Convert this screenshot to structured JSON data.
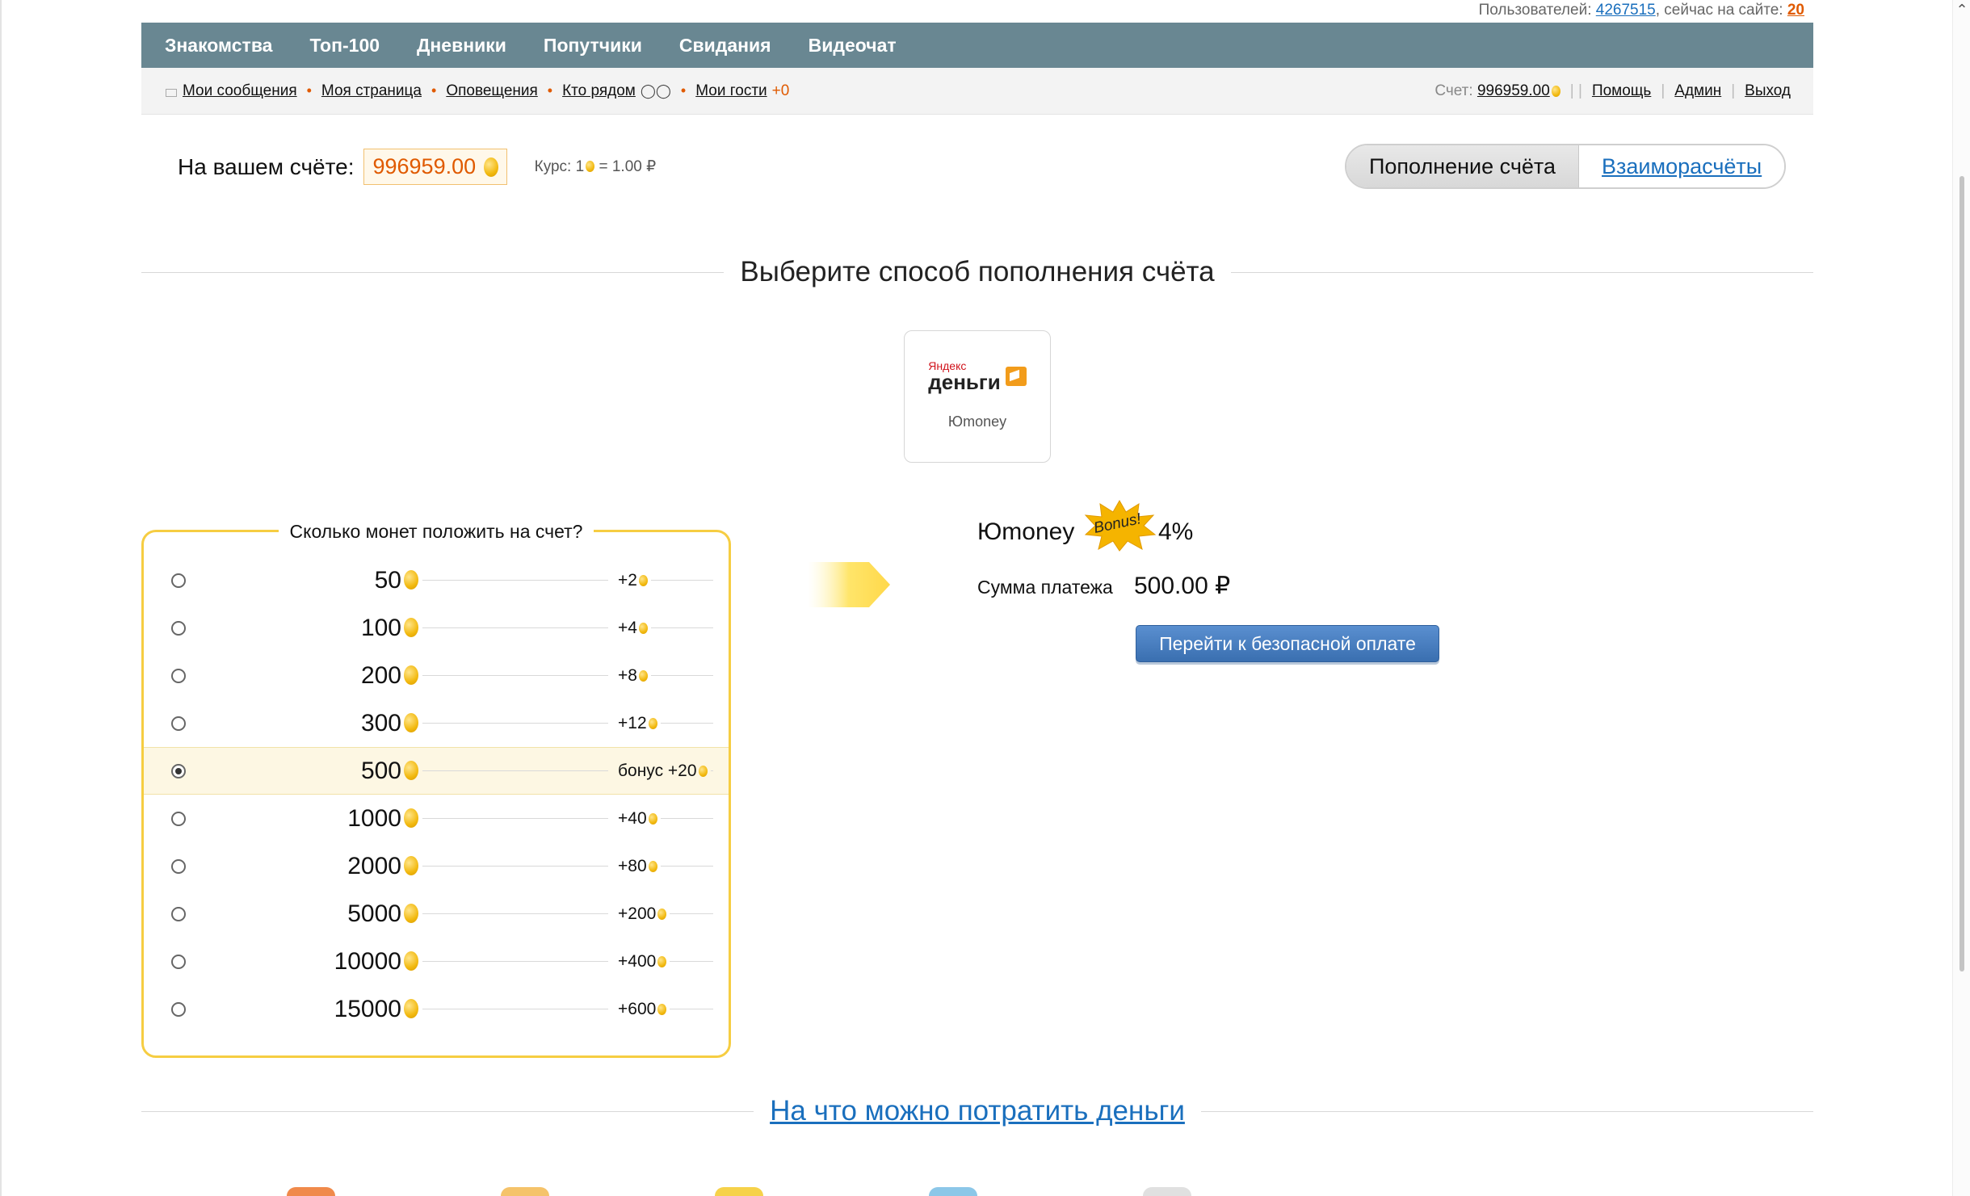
{
  "header": {
    "users_label": "Пользователей:",
    "users_count": "4267515",
    "online_label": ", сейчас на сайте:",
    "online_count": "20"
  },
  "topnav": [
    "Знакомства",
    "Топ-100",
    "Дневники",
    "Попутчики",
    "Свидания",
    "Видеочат"
  ],
  "subnav": {
    "messages": "Мои сообщения",
    "my_page": "Моя страница",
    "notifications": "Оповещения",
    "nearby": "Кто рядом",
    "guests": "Мои гости",
    "guests_count": "+0",
    "account_label": "Счет:",
    "account_value": "996959.00",
    "help": "Помощь",
    "admin": "Админ",
    "logout": "Выход"
  },
  "balance": {
    "label": "На вашем счёте:",
    "value": "996959.00",
    "rate_prefix": "Курс: 1",
    "rate_suffix": "= 1.00 ₽"
  },
  "tabs": {
    "topup": "Пополнение счёта",
    "settlements": "Взаиморасчёты"
  },
  "choose_title": "Выберите способ пополнения счёта",
  "method": {
    "logo_line1": "Яндекс",
    "logo_line2": "деньги",
    "name": "Юmoney"
  },
  "amounts": {
    "legend": "Сколько монет положить на счет?",
    "selected_index": 4,
    "rows": [
      {
        "value": "50",
        "bonus": "+2"
      },
      {
        "value": "100",
        "bonus": "+4"
      },
      {
        "value": "200",
        "bonus": "+8"
      },
      {
        "value": "300",
        "bonus": "+12"
      },
      {
        "value": "500",
        "bonus": "бонус +20"
      },
      {
        "value": "1000",
        "bonus": "+40"
      },
      {
        "value": "2000",
        "bonus": "+80"
      },
      {
        "value": "5000",
        "bonus": "+200"
      },
      {
        "value": "10000",
        "bonus": "+400"
      },
      {
        "value": "15000",
        "bonus": "+600"
      }
    ]
  },
  "payment": {
    "method_name": "Юmoney",
    "bonus_badge": "Bonus!",
    "percent": "4%",
    "sum_label": "Сумма платежа",
    "sum_value": "500.00 ₽",
    "pay_button": "Перейти к безопасной оплате"
  },
  "spend_title": "На что можно потратить деньги",
  "colors": {
    "nav_bg": "#698792",
    "accent_orange": "#e05a00",
    "link_blue": "#1a6fbd",
    "frame_yellow": "#f6cd42",
    "button_blue": "#3a6fb0"
  }
}
